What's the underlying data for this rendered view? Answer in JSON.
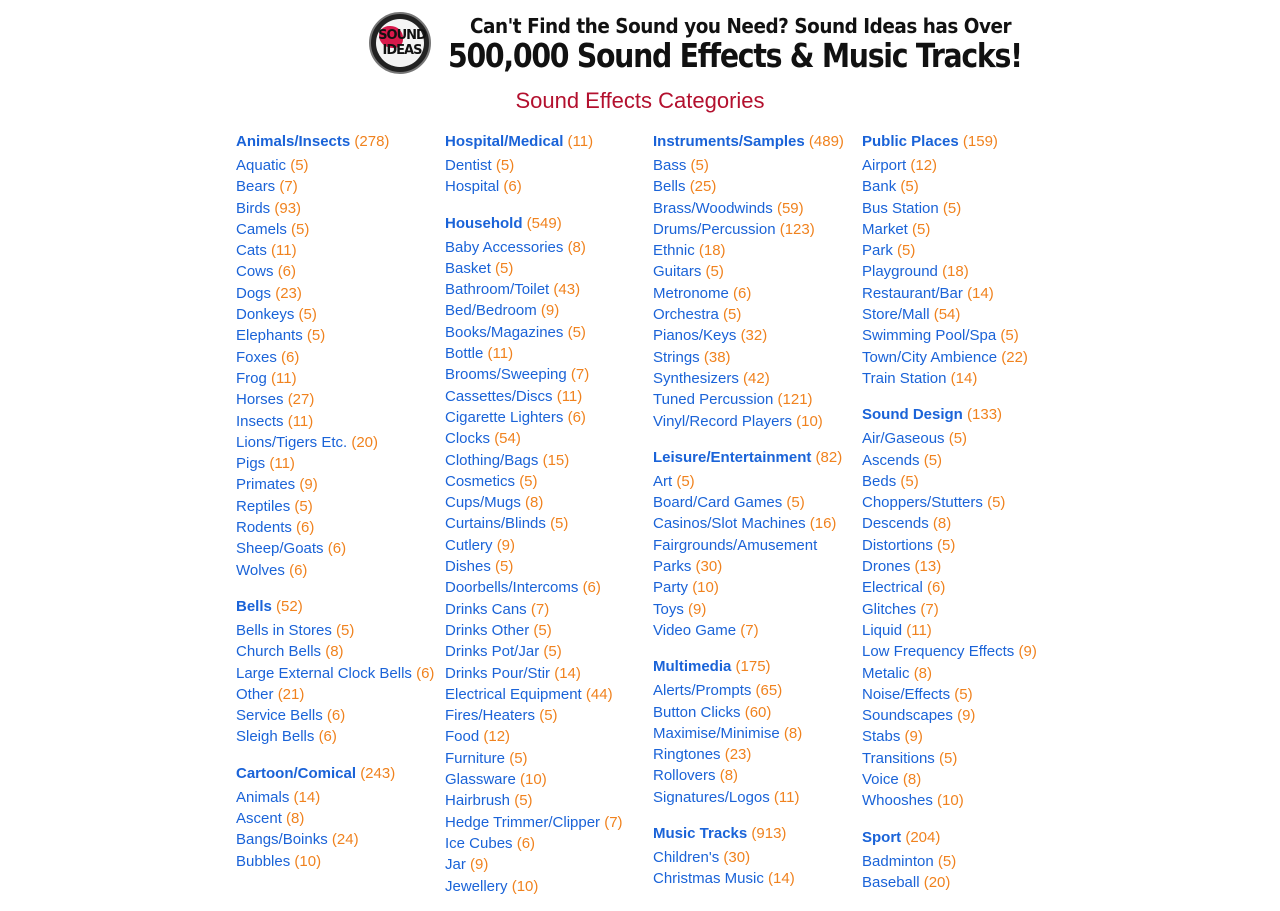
{
  "banner": {
    "logo_line1": "SOUND",
    "logo_line2": "IDEAS",
    "tagline_top": "Can't Find the Sound you Need? Sound Ideas has Over",
    "tagline_bottom": "500,000 Sound Effects & Music Tracks!"
  },
  "page_title": "Sound Effects Categories",
  "colors": {
    "link": "#1a63d8",
    "count": "#f0821e",
    "heading": "#b3102e"
  },
  "columns": [
    [
      {
        "title": "Animals/Insects",
        "count": "(278)",
        "items": [
          [
            "Aquatic",
            "(5)"
          ],
          [
            "Bears",
            "(7)"
          ],
          [
            "Birds",
            "(93)"
          ],
          [
            "Camels",
            "(5)"
          ],
          [
            "Cats",
            "(11)"
          ],
          [
            "Cows",
            "(6)"
          ],
          [
            "Dogs",
            "(23)"
          ],
          [
            "Donkeys",
            "(5)"
          ],
          [
            "Elephants",
            "(5)"
          ],
          [
            "Foxes",
            "(6)"
          ],
          [
            "Frog",
            "(11)"
          ],
          [
            "Horses",
            "(27)"
          ],
          [
            "Insects",
            "(11)"
          ],
          [
            "Lions/Tigers Etc.",
            "(20)"
          ],
          [
            "Pigs",
            "(11)"
          ],
          [
            "Primates",
            "(9)"
          ],
          [
            "Reptiles",
            "(5)"
          ],
          [
            "Rodents",
            "(6)"
          ],
          [
            "Sheep/Goats",
            "(6)"
          ],
          [
            "Wolves",
            "(6)"
          ]
        ]
      },
      {
        "title": "Bells",
        "count": "(52)",
        "items": [
          [
            "Bells in Stores",
            "(5)"
          ],
          [
            "Church Bells",
            "(8)"
          ],
          [
            "Large External Clock Bells",
            "(6)"
          ],
          [
            "Other",
            "(21)"
          ],
          [
            "Service Bells",
            "(6)"
          ],
          [
            "Sleigh Bells",
            "(6)"
          ]
        ]
      },
      {
        "title": "Cartoon/Comical",
        "count": "(243)",
        "items": [
          [
            "Animals",
            "(14)"
          ],
          [
            "Ascent",
            "(8)"
          ],
          [
            "Bangs/Boinks",
            "(24)"
          ],
          [
            "Bubbles",
            "(10)"
          ]
        ]
      }
    ],
    [
      {
        "title": "Hospital/Medical",
        "count": "(11)",
        "items": [
          [
            "Dentist",
            "(5)"
          ],
          [
            "Hospital",
            "(6)"
          ]
        ]
      },
      {
        "title": "Household",
        "count": "(549)",
        "items": [
          [
            "Baby Accessories",
            "(8)"
          ],
          [
            "Basket",
            "(5)"
          ],
          [
            "Bathroom/Toilet",
            "(43)"
          ],
          [
            "Bed/Bedroom",
            "(9)"
          ],
          [
            "Books/Magazines",
            "(5)"
          ],
          [
            "Bottle",
            "(11)"
          ],
          [
            "Brooms/Sweeping",
            "(7)"
          ],
          [
            "Cassettes/Discs",
            "(11)"
          ],
          [
            "Cigarette Lighters",
            "(6)"
          ],
          [
            "Clocks",
            "(54)"
          ],
          [
            "Clothing/Bags",
            "(15)"
          ],
          [
            "Cosmetics",
            "(5)"
          ],
          [
            "Cups/Mugs",
            "(8)"
          ],
          [
            "Curtains/Blinds",
            "(5)"
          ],
          [
            "Cutlery",
            "(9)"
          ],
          [
            "Dishes",
            "(5)"
          ],
          [
            "Doorbells/Intercoms",
            "(6)"
          ],
          [
            "Drinks Cans",
            "(7)"
          ],
          [
            "Drinks Other",
            "(5)"
          ],
          [
            "Drinks Pot/Jar",
            "(5)"
          ],
          [
            "Drinks Pour/Stir",
            "(14)"
          ],
          [
            "Electrical Equipment",
            "(44)"
          ],
          [
            "Fires/Heaters",
            "(5)"
          ],
          [
            "Food",
            "(12)"
          ],
          [
            "Furniture",
            "(5)"
          ],
          [
            "Glassware",
            "(10)"
          ],
          [
            "Hairbrush",
            "(5)"
          ],
          [
            "Hedge Trimmer/Clipper",
            "(7)"
          ],
          [
            "Ice Cubes",
            "(6)"
          ],
          [
            "Jar",
            "(9)"
          ],
          [
            "Jewellery",
            "(10)"
          ]
        ]
      }
    ],
    [
      {
        "title": "Instruments/Samples",
        "count": "(489)",
        "items": [
          [
            "Bass",
            "(5)"
          ],
          [
            "Bells",
            "(25)"
          ],
          [
            "Brass/Woodwinds",
            "(59)"
          ],
          [
            "Drums/Percussion",
            "(123)"
          ],
          [
            "Ethnic",
            "(18)"
          ],
          [
            "Guitars",
            "(5)"
          ],
          [
            "Metronome",
            "(6)"
          ],
          [
            "Orchestra",
            "(5)"
          ],
          [
            "Pianos/Keys",
            "(32)"
          ],
          [
            "Strings",
            "(38)"
          ],
          [
            "Synthesizers",
            "(42)"
          ],
          [
            "Tuned Percussion",
            "(121)"
          ],
          [
            "Vinyl/Record Players",
            "(10)"
          ]
        ]
      },
      {
        "title": "Leisure/Entertainment",
        "count": "(82)",
        "items": [
          [
            "Art",
            "(5)"
          ],
          [
            "Board/Card Games",
            "(5)"
          ],
          [
            "Casinos/Slot Machines",
            "(16)"
          ],
          [
            "Fairgrounds/Amusement Parks",
            "(30)"
          ],
          [
            "Party",
            "(10)"
          ],
          [
            "Toys",
            "(9)"
          ],
          [
            "Video Game",
            "(7)"
          ]
        ]
      },
      {
        "title": "Multimedia",
        "count": "(175)",
        "items": [
          [
            "Alerts/Prompts",
            "(65)"
          ],
          [
            "Button Clicks",
            "(60)"
          ],
          [
            "Maximise/Minimise",
            "(8)"
          ],
          [
            "Ringtones",
            "(23)"
          ],
          [
            "Rollovers",
            "(8)"
          ],
          [
            "Signatures/Logos",
            "(11)"
          ]
        ]
      },
      {
        "title": "Music Tracks",
        "count": "(913)",
        "items": [
          [
            "Children's",
            "(30)"
          ],
          [
            "Christmas Music",
            "(14)"
          ]
        ]
      }
    ],
    [
      {
        "title": "Public Places",
        "count": "(159)",
        "items": [
          [
            "Airport",
            "(12)"
          ],
          [
            "Bank",
            "(5)"
          ],
          [
            "Bus Station",
            "(5)"
          ],
          [
            "Market",
            "(5)"
          ],
          [
            "Park",
            "(5)"
          ],
          [
            "Playground",
            "(18)"
          ],
          [
            "Restaurant/Bar",
            "(14)"
          ],
          [
            "Store/Mall",
            "(54)"
          ],
          [
            "Swimming Pool/Spa",
            "(5)"
          ],
          [
            "Town/City Ambience",
            "(22)"
          ],
          [
            "Train Station",
            "(14)"
          ]
        ]
      },
      {
        "title": "Sound Design",
        "count": "(133)",
        "items": [
          [
            "Air/Gaseous",
            "(5)"
          ],
          [
            "Ascends",
            "(5)"
          ],
          [
            "Beds",
            "(5)"
          ],
          [
            "Choppers/Stutters",
            "(5)"
          ],
          [
            "Descends",
            "(8)"
          ],
          [
            "Distortions",
            "(5)"
          ],
          [
            "Drones",
            "(13)"
          ],
          [
            "Electrical",
            "(6)"
          ],
          [
            "Glitches",
            "(7)"
          ],
          [
            "Liquid",
            "(11)"
          ],
          [
            "Low Frequency Effects",
            "(9)"
          ],
          [
            "Metalic",
            "(8)"
          ],
          [
            "Noise/Effects",
            "(5)"
          ],
          [
            "Soundscapes",
            "(9)"
          ],
          [
            "Stabs",
            "(9)"
          ],
          [
            "Transitions",
            "(5)"
          ],
          [
            "Voice",
            "(8)"
          ],
          [
            "Whooshes",
            "(10)"
          ]
        ]
      },
      {
        "title": "Sport",
        "count": "(204)",
        "items": [
          [
            "Badminton",
            "(5)"
          ],
          [
            "Baseball",
            "(20)"
          ]
        ]
      }
    ]
  ]
}
